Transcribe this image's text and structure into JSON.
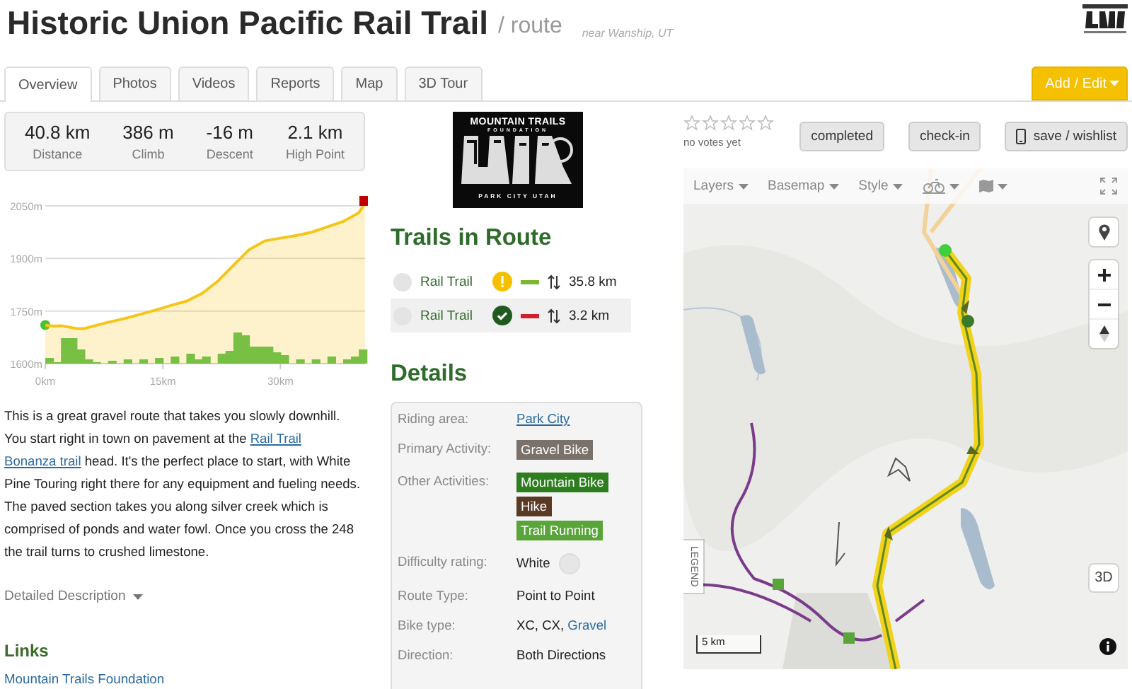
{
  "header": {
    "title": "Historic Union Pacific Rail Trail",
    "subtitle": "/ route",
    "location": "near Wanship, UT"
  },
  "tabs": [
    {
      "label": "Overview",
      "selected": true
    },
    {
      "label": "Photos",
      "selected": false
    },
    {
      "label": "Videos",
      "selected": false
    },
    {
      "label": "Reports",
      "selected": false
    },
    {
      "label": "Map",
      "selected": false
    },
    {
      "label": "3D Tour",
      "selected": false
    }
  ],
  "add_button": {
    "label": "Add / Edit"
  },
  "stats": [
    {
      "value": "40.8 km",
      "label": "Distance"
    },
    {
      "value": "386 m",
      "label": "Climb"
    },
    {
      "value": "-16 m",
      "label": "Descent"
    },
    {
      "value": "2.1 km",
      "label": "High Point"
    }
  ],
  "elevation": {
    "chart_data": {
      "type": "area",
      "x": [
        0,
        1,
        2,
        3,
        4,
        5,
        6,
        8,
        10,
        12,
        14,
        16,
        18,
        20,
        22,
        24,
        26,
        28,
        30,
        32,
        34,
        36,
        38,
        40,
        40.8
      ],
      "series": [
        {
          "color": "#f5c518",
          "values": [
            1710,
            1707,
            1708,
            1704,
            1700,
            1700,
            1706,
            1718,
            1728,
            1740,
            1752,
            1766,
            1778,
            1800,
            1835,
            1880,
            1925,
            1950,
            1958,
            1965,
            1975,
            1990,
            2005,
            2030,
            2058
          ]
        }
      ],
      "xlim": [
        0,
        40.8
      ],
      "ylim": [
        1600,
        2060
      ],
      "xticks": [
        {
          "value": 0,
          "label": "0km"
        },
        {
          "value": 15,
          "label": "15km"
        },
        {
          "value": 30,
          "label": "30km"
        }
      ],
      "yticks": [
        {
          "value": 1600,
          "label": "1600m"
        },
        {
          "value": 1750,
          "label": "1750m"
        },
        {
          "value": 1900,
          "label": "1900m"
        },
        {
          "value": 2050,
          "label": "2050m"
        }
      ]
    }
  },
  "description": [
    {
      "kind": "text",
      "text": "This is a great gravel route that takes you slowly downhill. You start right in town on pavement at the "
    },
    {
      "kind": "link",
      "text": "Rail Trail"
    },
    {
      "kind": "link",
      "text": "Bonanza trail"
    },
    {
      "kind": "text",
      "text": " head. It's the perfect place to start, with White Pine Touring right there for any equipment and fueling needs. The paved section takes you along silver creek which is comprised of ponds and water fowl. Once you cross the 248 the trail turns to crushed limestone."
    }
  ],
  "detailed_description": "Detailed Description",
  "links": {
    "heading": "Links",
    "items": [
      "Mountain Trails Foundation"
    ]
  },
  "logo": {
    "name": "MOUNTAIN TRAILS",
    "sub": "FOUNDATION",
    "place": "PARK CITY UTAH"
  },
  "trails_in_route": {
    "heading": "Trails in Route",
    "trails": [
      {
        "name": "Rail Trail",
        "kind": "warning",
        "color": "#7cb82f",
        "distance": "35.8 km",
        "selected": false
      },
      {
        "name": "Rail Trail",
        "kind": "ok",
        "color": "#d0202e",
        "distance": "3.2 km",
        "selected": true
      }
    ]
  },
  "details": {
    "heading": "Details",
    "rows": [
      {
        "label": "Riding area:",
        "kind": "link",
        "value": "Park City"
      },
      {
        "label": "Primary Activity:",
        "kind": "tags",
        "tags": [
          {
            "text": "Gravel Bike",
            "color": "#7a716a"
          }
        ]
      },
      {
        "label": "Other Activities:",
        "kind": "tags",
        "tags": [
          {
            "text": "Mountain Bike",
            "color": "#2e7d1f"
          },
          {
            "text": "Hike",
            "color": "#5b3a24"
          },
          {
            "text": "Trail Running",
            "color": "#5aa53a"
          }
        ]
      },
      {
        "label": "Difficulty rating:",
        "kind": "difficulty",
        "value": "White"
      },
      {
        "label": "Route Type:",
        "kind": "text",
        "value": "Point to Point"
      },
      {
        "label": "Bike type:",
        "kind": "parts",
        "parts": [
          {
            "kind": "text",
            "text": "XC, CX, "
          },
          {
            "kind": "link",
            "text": "Gravel"
          }
        ]
      },
      {
        "label": "Direction:",
        "kind": "text",
        "value": "Both Directions"
      }
    ]
  },
  "rating": {
    "stars": 0,
    "caption": "no votes yet"
  },
  "actions": [
    {
      "label": "completed",
      "kind": "plain"
    },
    {
      "label": "check-in",
      "kind": "plain"
    },
    {
      "label": "save / wishlist",
      "kind": "phone"
    }
  ],
  "map": {
    "menus": [
      "Layers",
      "Basemap",
      "Style"
    ],
    "legend": "LEGEND",
    "scale": "5 km",
    "three_d": "3D"
  }
}
